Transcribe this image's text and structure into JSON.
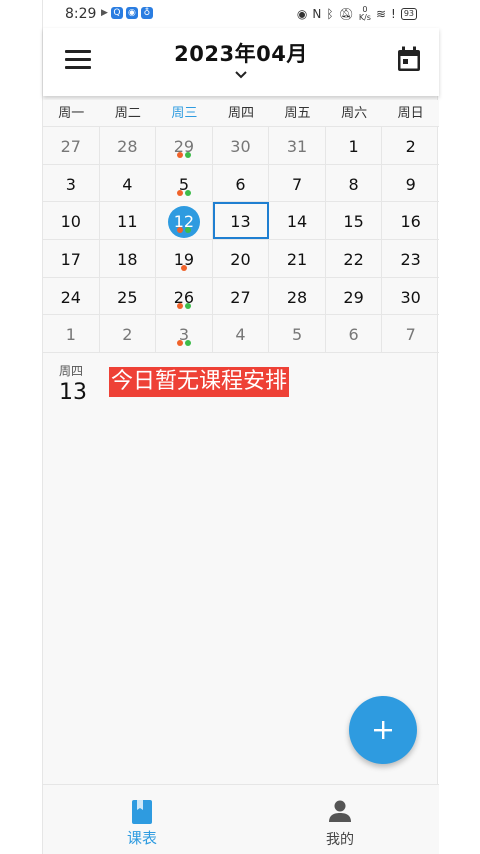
{
  "status_bar": {
    "time": "8:29",
    "net_speed_top": "0",
    "net_speed_bottom": "K/s",
    "battery": "93"
  },
  "header": {
    "title": "2023年04月"
  },
  "weekdays": [
    "周一",
    "周二",
    "周三",
    "周四",
    "周五",
    "周六",
    "周日"
  ],
  "calendar": {
    "weeks": [
      [
        {
          "n": "27",
          "m": true
        },
        {
          "n": "28",
          "m": true
        },
        {
          "n": "29",
          "m": true,
          "dots": [
            "orange",
            "green"
          ]
        },
        {
          "n": "30",
          "m": true
        },
        {
          "n": "31",
          "m": true
        },
        {
          "n": "1"
        },
        {
          "n": "2"
        }
      ],
      [
        {
          "n": "3"
        },
        {
          "n": "4"
        },
        {
          "n": "5",
          "dots": [
            "orange",
            "green"
          ]
        },
        {
          "n": "6"
        },
        {
          "n": "7"
        },
        {
          "n": "8"
        },
        {
          "n": "9"
        }
      ],
      [
        {
          "n": "10"
        },
        {
          "n": "11"
        },
        {
          "n": "12",
          "selected": true,
          "dots": [
            "orange",
            "green"
          ]
        },
        {
          "n": "13",
          "today": true
        },
        {
          "n": "14"
        },
        {
          "n": "15"
        },
        {
          "n": "16"
        }
      ],
      [
        {
          "n": "17"
        },
        {
          "n": "18"
        },
        {
          "n": "19",
          "dots": [
            "orange"
          ]
        },
        {
          "n": "20"
        },
        {
          "n": "21"
        },
        {
          "n": "22"
        },
        {
          "n": "23"
        }
      ],
      [
        {
          "n": "24"
        },
        {
          "n": "25"
        },
        {
          "n": "26",
          "dots": [
            "orange",
            "green"
          ]
        },
        {
          "n": "27"
        },
        {
          "n": "28"
        },
        {
          "n": "29"
        },
        {
          "n": "30"
        }
      ],
      [
        {
          "n": "1",
          "m": true
        },
        {
          "n": "2",
          "m": true
        },
        {
          "n": "3",
          "m": true,
          "dots": [
            "orange",
            "green"
          ]
        },
        {
          "n": "4",
          "m": true
        },
        {
          "n": "5",
          "m": true
        },
        {
          "n": "6",
          "m": true
        },
        {
          "n": "7",
          "m": true
        }
      ]
    ]
  },
  "day_info": {
    "weekday": "周四",
    "day": "13",
    "empty_message": "今日暂无课程安排"
  },
  "bottom_nav": {
    "schedule_label": "课表",
    "mine_label": "我的"
  },
  "colors": {
    "accent": "#2e9be0",
    "today_border": "#1f7fd1",
    "dot_orange": "#f0622a",
    "dot_green": "#3dbb4a",
    "message_bg": "#ee4136"
  }
}
